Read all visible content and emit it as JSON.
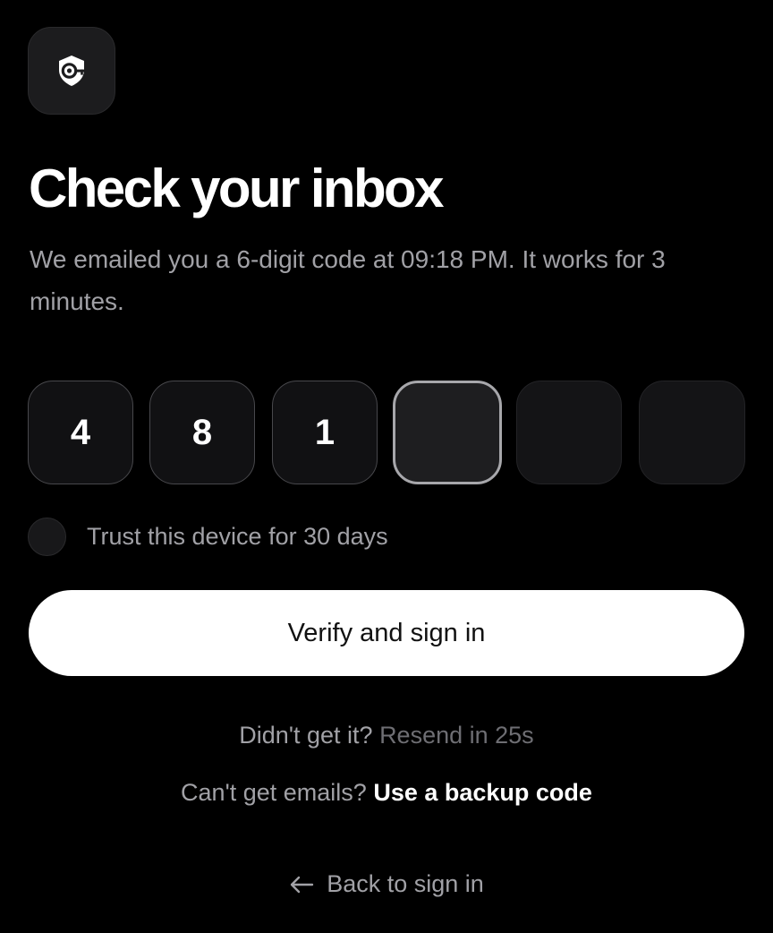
{
  "brand": {
    "logo_icon": "shield-key-icon"
  },
  "title": "Check your inbox",
  "subtitle": "We emailed you a 6-digit code at 09:18 PM. It works for 3 minutes.",
  "otp": {
    "digits": [
      "4",
      "8",
      "1",
      "",
      "",
      ""
    ],
    "active_index": 3
  },
  "trust": {
    "label": "Trust this device for 30 days",
    "checked": false
  },
  "verify_button_label": "Verify and sign in",
  "resend": {
    "prompt": "Didn't get it?",
    "link": "Resend in 25s"
  },
  "backup": {
    "prompt": "Can't get emails?",
    "link": "Use a backup code"
  },
  "back": {
    "icon": "arrow-left-icon",
    "label": "Back to sign in"
  },
  "colors": {
    "background": "#000000",
    "button_bg": "#ffffff",
    "muted_text": "#a1a1a6"
  }
}
